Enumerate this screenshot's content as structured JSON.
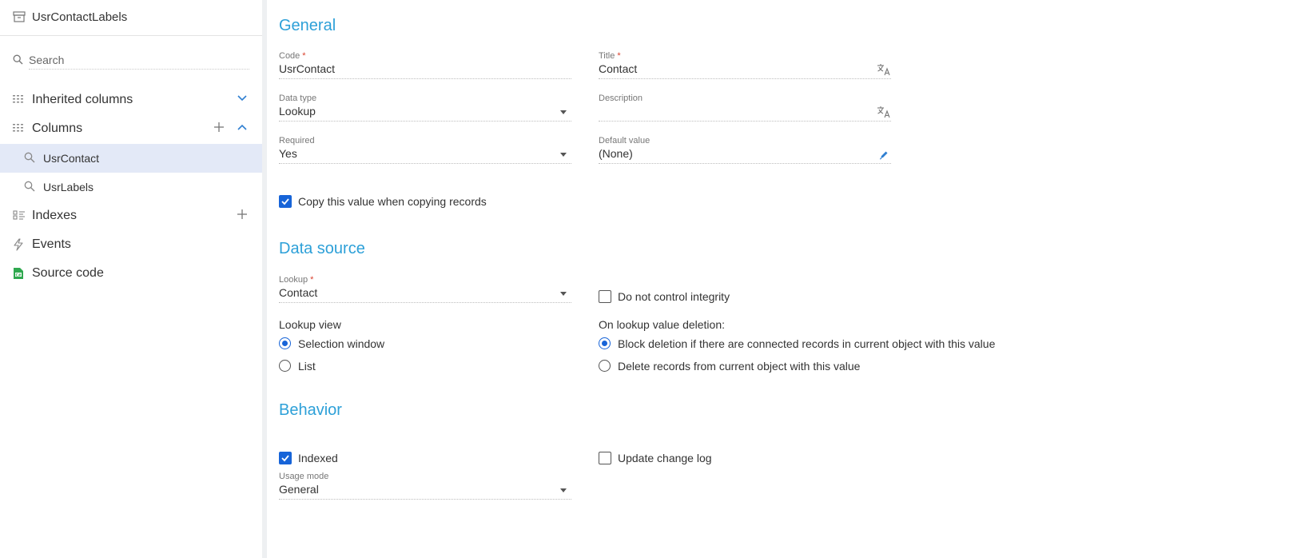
{
  "sidebar": {
    "title": "UsrContactLabels",
    "search_placeholder": "Search",
    "items": [
      {
        "label": "Inherited columns",
        "icon": "columns-icon"
      },
      {
        "label": "Columns",
        "icon": "columns-icon"
      },
      {
        "label": "UsrContact",
        "icon": "lookup-search-icon",
        "selected": true
      },
      {
        "label": "UsrLabels",
        "icon": "lookup-search-icon"
      },
      {
        "label": "Indexes",
        "icon": "index-icon"
      },
      {
        "label": "Events",
        "icon": "lightning-icon"
      },
      {
        "label": "Source code",
        "icon": "cs-file-icon"
      }
    ]
  },
  "general": {
    "title": "General",
    "code": {
      "label": "Code",
      "value": "UsrContact"
    },
    "title_field": {
      "label": "Title",
      "value": "Contact"
    },
    "data_type": {
      "label": "Data type",
      "value": "Lookup"
    },
    "description": {
      "label": "Description",
      "value": ""
    },
    "required": {
      "label": "Required",
      "value": "Yes"
    },
    "default_value": {
      "label": "Default value",
      "value": "(None)"
    },
    "copy_value": {
      "label": "Copy this value when copying records",
      "checked": true
    }
  },
  "data_source": {
    "title": "Data source",
    "lookup": {
      "label": "Lookup",
      "value": "Contact"
    },
    "no_integrity": {
      "label": "Do not control integrity",
      "checked": false
    },
    "lookup_view": {
      "label": "Lookup view",
      "options": [
        "Selection window",
        "List"
      ],
      "selected": "Selection window"
    },
    "on_deletion": {
      "label": "On lookup value deletion:",
      "options": [
        "Block deletion if there are connected records in current object with this value",
        "Delete records from current object with this value"
      ],
      "selected": "Block deletion if there are connected records in current object with this value"
    }
  },
  "behavior": {
    "title": "Behavior",
    "indexed": {
      "label": "Indexed",
      "checked": true
    },
    "update_log": {
      "label": "Update change log",
      "checked": false
    },
    "usage_mode": {
      "label": "Usage mode",
      "value": "General"
    }
  },
  "colors": {
    "accent": "#2da0d8",
    "primary": "#1764d8",
    "selected_bg": "#e3e9f7",
    "required": "#d9412e"
  }
}
